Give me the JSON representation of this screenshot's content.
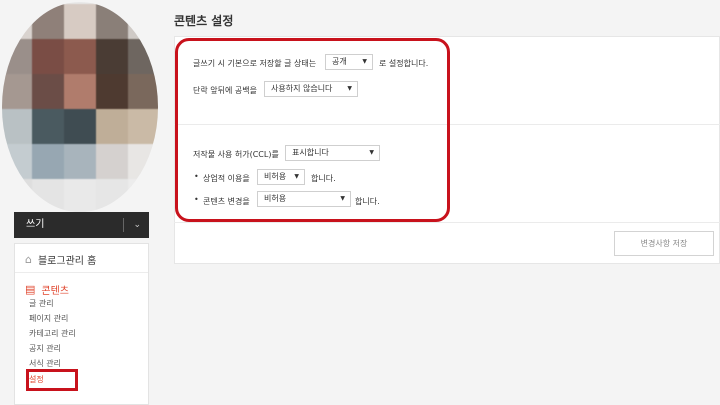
{
  "sidebar": {
    "write_label": "쓰기",
    "home_label": "블로그관리 홈",
    "content_label": "콘텐츠",
    "items": [
      {
        "label": "글 관리"
      },
      {
        "label": "페이지 관리"
      },
      {
        "label": "카테고리 관리"
      },
      {
        "label": "공지 관리"
      },
      {
        "label": "서식 관리"
      },
      {
        "label": "설정"
      }
    ]
  },
  "main": {
    "title": "콘텐츠 설정",
    "row1": {
      "prefix": "글쓰기 시 기본으로 저장할 글 상태는",
      "value": "공개",
      "suffix": "로 설정합니다."
    },
    "row2": {
      "prefix": "단락 앞뒤에 공백을",
      "value": "사용하지 않습니다"
    },
    "row3": {
      "prefix": "저작물 사용 허가(CCL)를",
      "value": "표시합니다"
    },
    "row4": {
      "prefix": "상업적 이용을",
      "value": "비허용",
      "suffix": "합니다."
    },
    "row5": {
      "prefix": "콘텐츠 변경을",
      "value": "비허용",
      "suffix": "합니다."
    },
    "save_label": "변경사항 저장"
  },
  "colors": {
    "accent": "#e0452d",
    "highlight": "#c8121c"
  }
}
